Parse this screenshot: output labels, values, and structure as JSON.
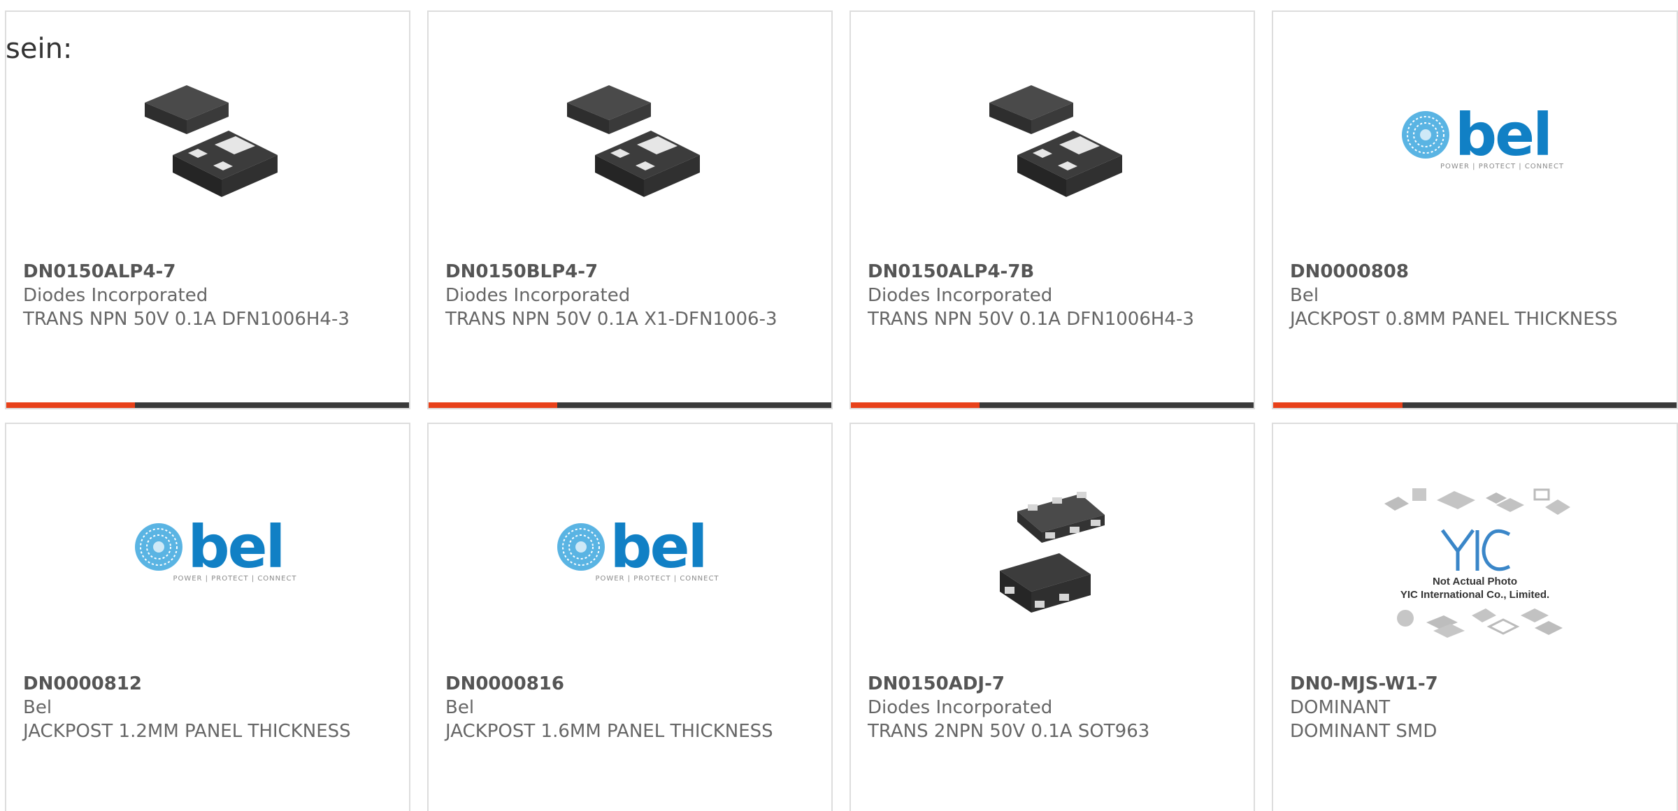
{
  "intro": "sein:",
  "colors": {
    "accent": "#e8411a",
    "track": "#3a3a3a",
    "brand_blue": "#1180c5"
  },
  "products": [
    {
      "part": "DN0150ALP4-7",
      "maker": "Diodes Incorporated",
      "desc": "TRANS NPN 50V 0.1A DFN1006H4-3",
      "image": "dfn3-package-icon",
      "progress": 0.32
    },
    {
      "part": "DN0150BLP4-7",
      "maker": "Diodes Incorporated",
      "desc": "TRANS NPN 50V 0.1A X1-DFN1006-3",
      "image": "dfn3-package-icon",
      "progress": 0.32
    },
    {
      "part": "DN0150ALP4-7B",
      "maker": "Diodes Incorporated",
      "desc": "TRANS NPN 50V 0.1A DFN1006H4-3",
      "image": "dfn3-package-icon",
      "progress": 0.32
    },
    {
      "part": "DN0000808",
      "maker": "Bel",
      "desc": "JACKPOST 0.8MM PANEL THICKNESS",
      "image": "bel-logo",
      "logo_word": "bel",
      "logo_tagline": "POWER | PROTECT | CONNECT",
      "progress": 0.32
    },
    {
      "part": "DN0000812",
      "maker": "Bel",
      "desc": "JACKPOST 1.2MM PANEL THICKNESS",
      "image": "bel-logo",
      "logo_word": "bel",
      "logo_tagline": "POWER | PROTECT | CONNECT"
    },
    {
      "part": "DN0000816",
      "maker": "Bel",
      "desc": "JACKPOST 1.6MM PANEL THICKNESS",
      "image": "bel-logo",
      "logo_word": "bel",
      "logo_tagline": "POWER | PROTECT | CONNECT"
    },
    {
      "part": "DN0150ADJ-7",
      "maker": "Diodes Incorporated",
      "desc": "TRANS 2NPN 50V 0.1A SOT963",
      "image": "sot963-package-icon"
    },
    {
      "part": "DN0-MJS-W1-7",
      "maker": "DOMINANT",
      "desc": "DOMINANT SMD",
      "image": "yic-placeholder",
      "placeholder_line1": "Not Actual Photo",
      "placeholder_line2": "YIC International Co., Limited."
    }
  ]
}
